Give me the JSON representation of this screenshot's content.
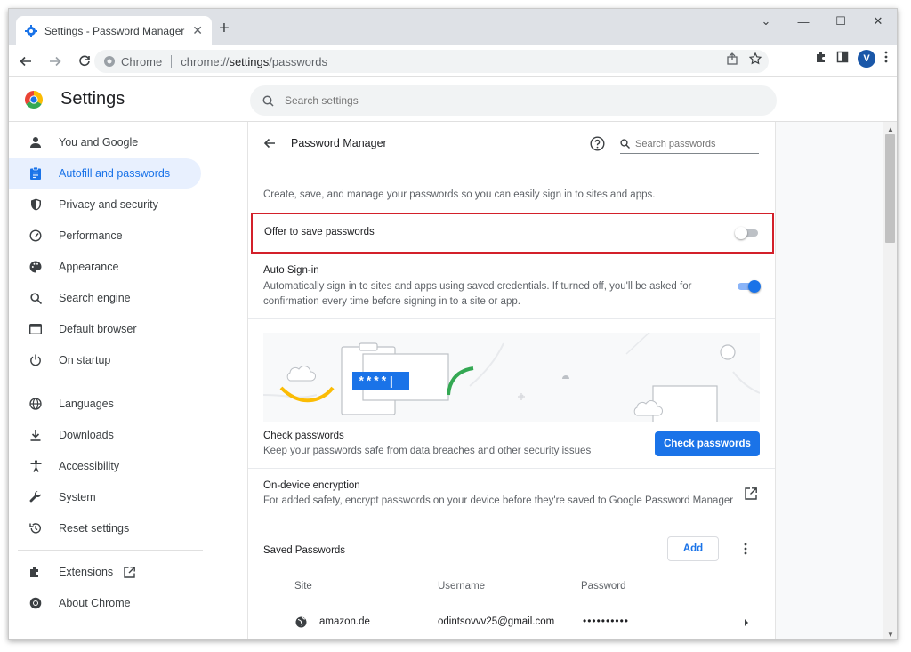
{
  "tab": {
    "title": "Settings - Password Manager",
    "close": "✕",
    "new_tab": "+"
  },
  "window_controls": {
    "minimize": "—",
    "maximize": "☐",
    "close": "✕",
    "tabsearch": "⌄"
  },
  "omnibox": {
    "chip": "Chrome",
    "url_prefix": "chrome://",
    "url_host": "settings",
    "url_path": "/passwords"
  },
  "profile": {
    "initial": "V"
  },
  "header": {
    "title": "Settings",
    "search_placeholder": "Search settings"
  },
  "sidebar": {
    "items": [
      {
        "label": "You and Google",
        "icon": "person-icon",
        "active": false
      },
      {
        "label": "Autofill and passwords",
        "icon": "clipboard-icon",
        "active": true
      },
      {
        "label": "Privacy and security",
        "icon": "shield-icon",
        "active": false
      },
      {
        "label": "Performance",
        "icon": "speedometer-icon",
        "active": false
      },
      {
        "label": "Appearance",
        "icon": "palette-icon",
        "active": false
      },
      {
        "label": "Search engine",
        "icon": "search-icon",
        "active": false
      },
      {
        "label": "Default browser",
        "icon": "browser-icon",
        "active": false
      },
      {
        "label": "On startup",
        "icon": "power-icon",
        "active": false
      },
      {
        "label": "Languages",
        "icon": "globe-icon",
        "active": false
      },
      {
        "label": "Downloads",
        "icon": "download-icon",
        "active": false
      },
      {
        "label": "Accessibility",
        "icon": "accessibility-icon",
        "active": false
      },
      {
        "label": "System",
        "icon": "wrench-icon",
        "active": false
      },
      {
        "label": "Reset settings",
        "icon": "reset-icon",
        "active": false
      },
      {
        "label": "Extensions",
        "icon": "puzzle-icon",
        "active": false
      },
      {
        "label": "About Chrome",
        "icon": "chrome-icon",
        "active": false
      }
    ]
  },
  "password_manager": {
    "title": "Password Manager",
    "search_placeholder": "Search passwords",
    "description": "Create, save, and manage your passwords so you can easily sign in to sites and apps.",
    "offer_to_save": {
      "label": "Offer to save passwords",
      "enabled": false
    },
    "auto_sign_in": {
      "title": "Auto Sign-in",
      "description": "Automatically sign in to sites and apps using saved credentials. If turned off, you'll be asked for confirmation every time before signing in to a site or app.",
      "enabled": true
    },
    "illustration": {
      "masked_text": "****|"
    },
    "check": {
      "title": "Check passwords",
      "description": "Keep your passwords safe from data breaches and other security issues",
      "button": "Check passwords"
    },
    "encryption": {
      "title": "On-device encryption",
      "description": "For added safety, encrypt passwords on your device before they're saved to Google Password Manager"
    },
    "saved": {
      "title": "Saved Passwords",
      "add_button": "Add",
      "columns": {
        "site": "Site",
        "username": "Username",
        "password": "Password"
      },
      "rows": [
        {
          "site": "amazon.de",
          "username": "odintsovvv25@gmail.com",
          "password": "••••••••••"
        }
      ]
    }
  },
  "colors": {
    "accent": "#1a73e8",
    "highlight_border": "#d3202a",
    "active_nav_bg": "#e8f0fe"
  }
}
